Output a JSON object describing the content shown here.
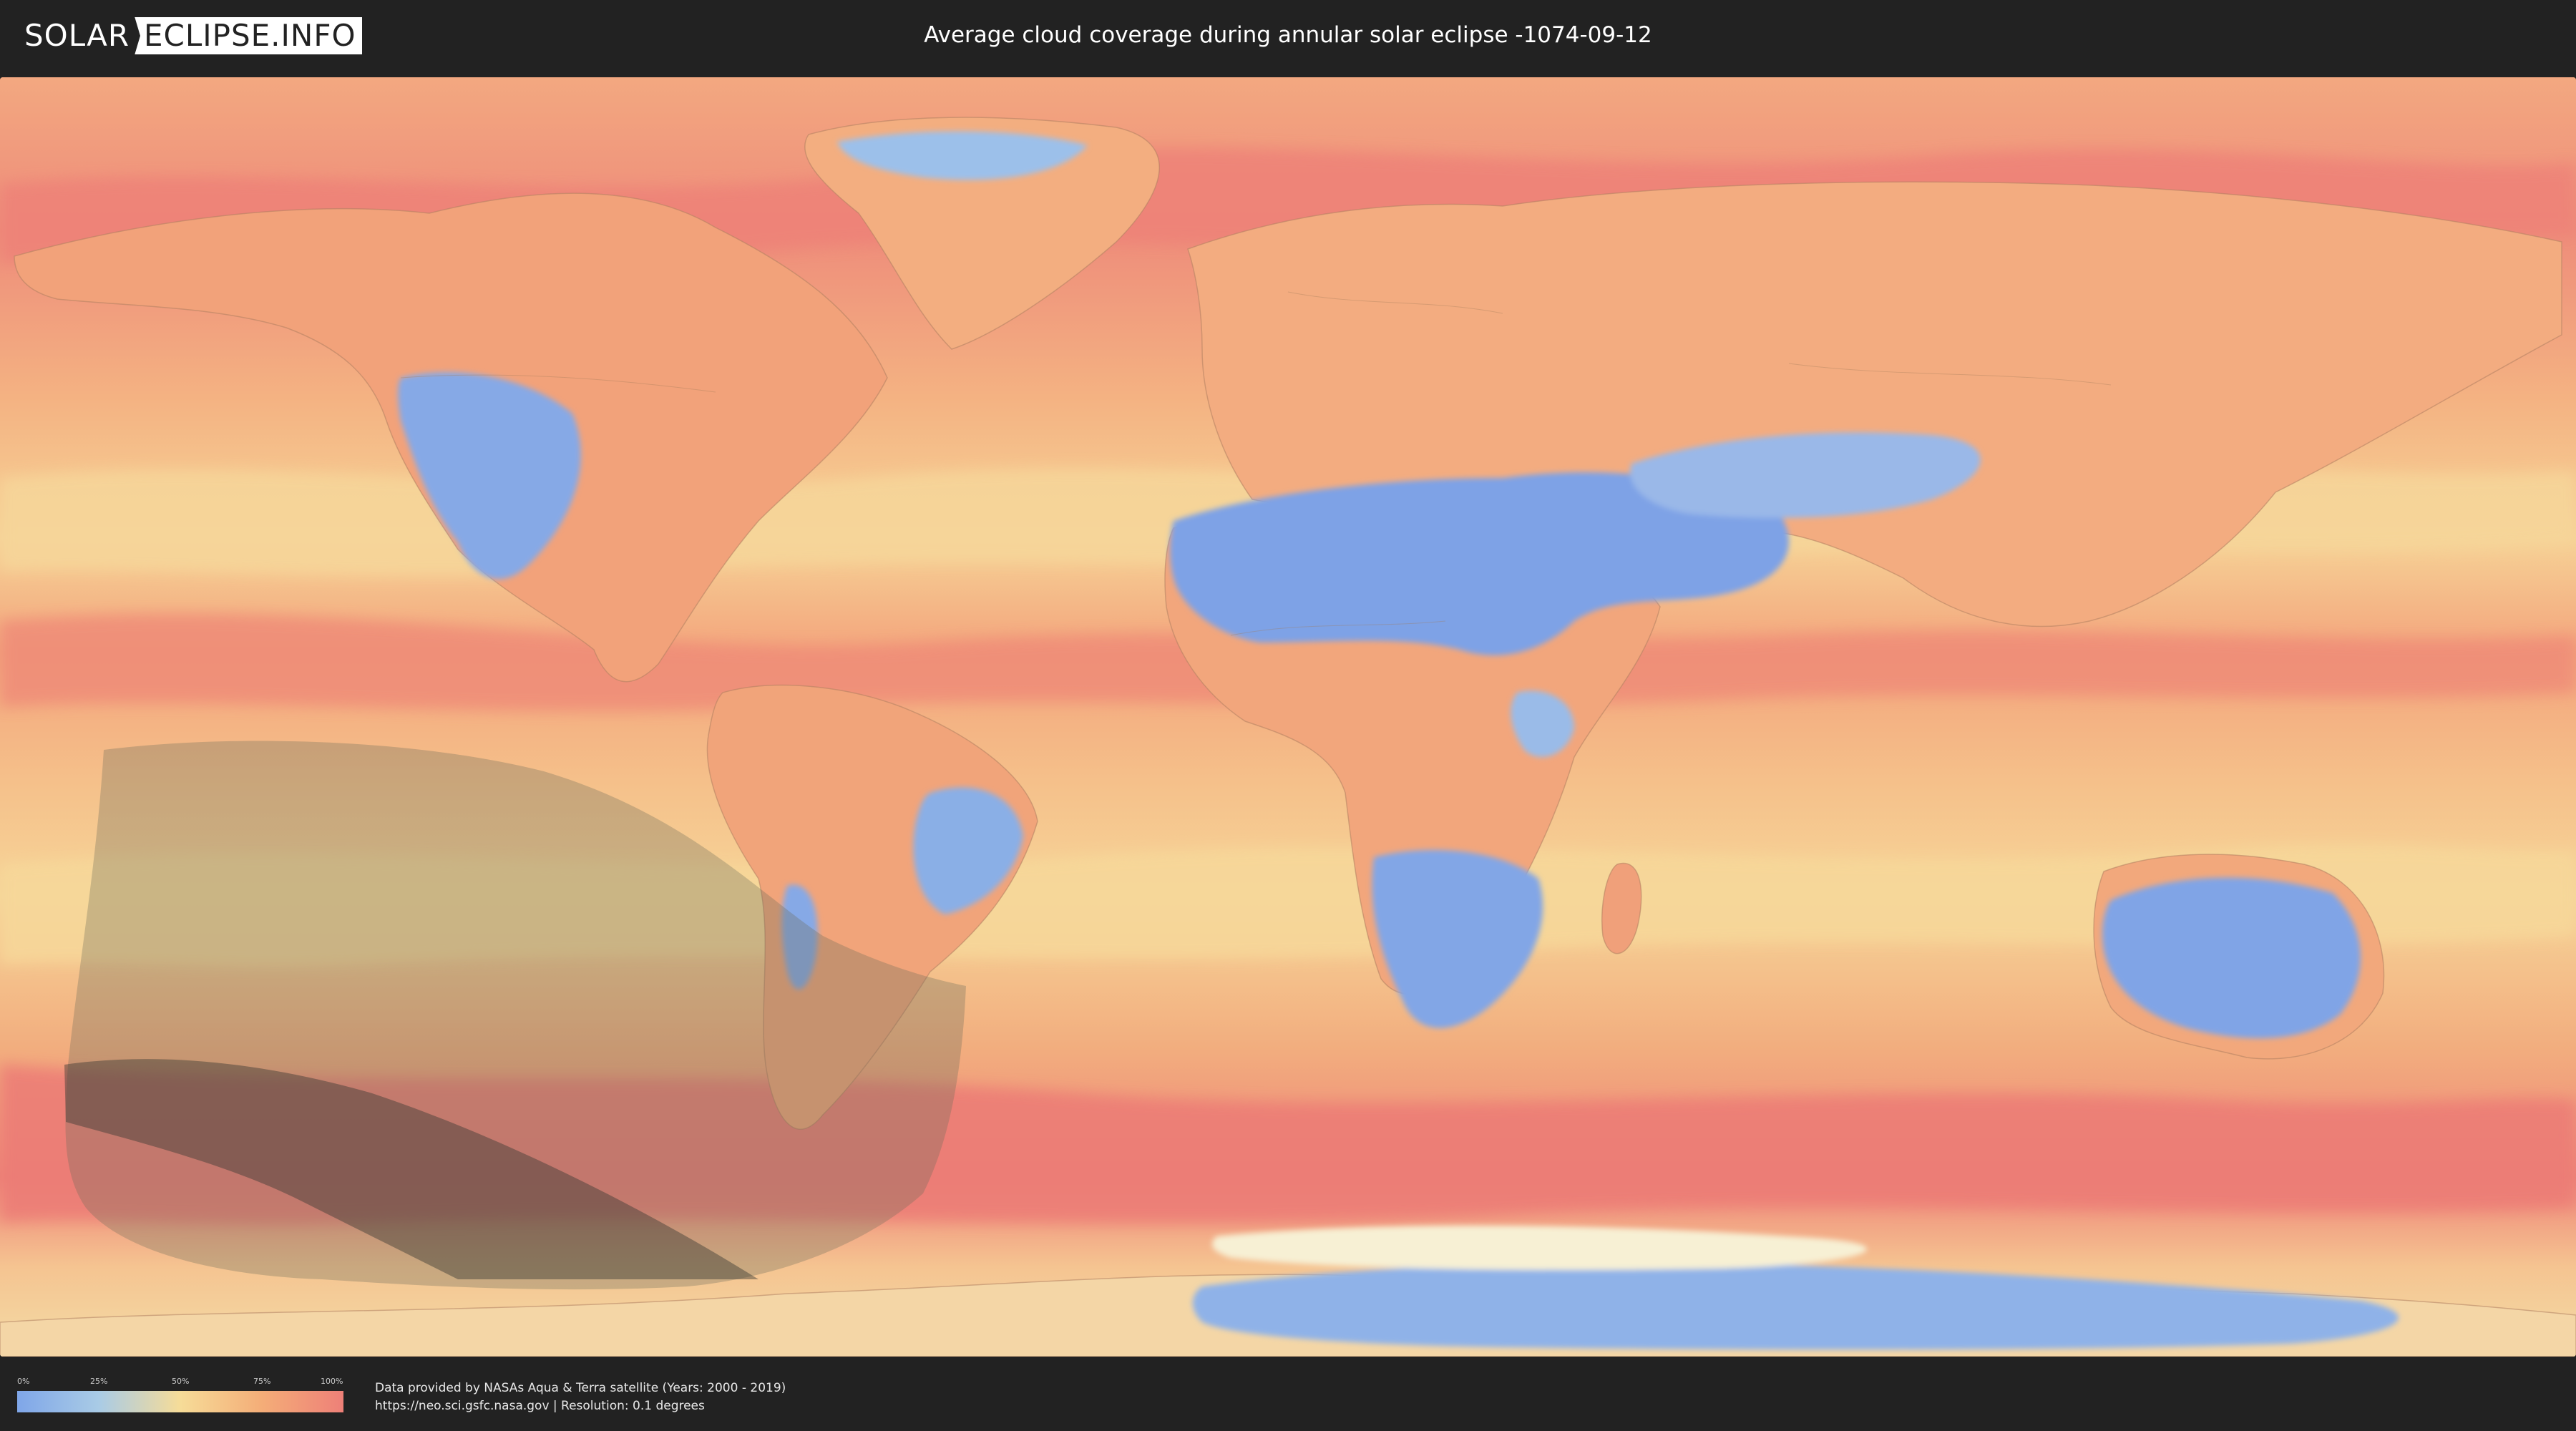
{
  "header": {
    "logo_part1": "SOLAR",
    "logo_part2": "ECLIPSE.INFO",
    "title": "Average cloud coverage during annular solar eclipse -1074-09-12"
  },
  "legend": {
    "ticks": [
      "0%",
      "25%",
      "50%",
      "75%",
      "100%"
    ],
    "colors": [
      "#7fa6e8",
      "#a9cbe6",
      "#f6dc98",
      "#f4ad78",
      "#ee8078"
    ]
  },
  "credits": {
    "line1": "Data provided by NASAs Aqua & Terra satellite (Years: 2000 - 2019)",
    "line2": "https://neo.sci.gsfc.nasa.gov | Resolution: 0.1 degrees"
  },
  "map": {
    "projection": "equirectangular",
    "colors": {
      "clear": "#7fa6e8",
      "low": "#a9cbe6",
      "mid": "#f6dc98",
      "high": "#f4ad78",
      "overcast": "#ee8078",
      "eclipse_shadow": "#6e6e5a",
      "annularity_path": "#3a3a32"
    }
  }
}
